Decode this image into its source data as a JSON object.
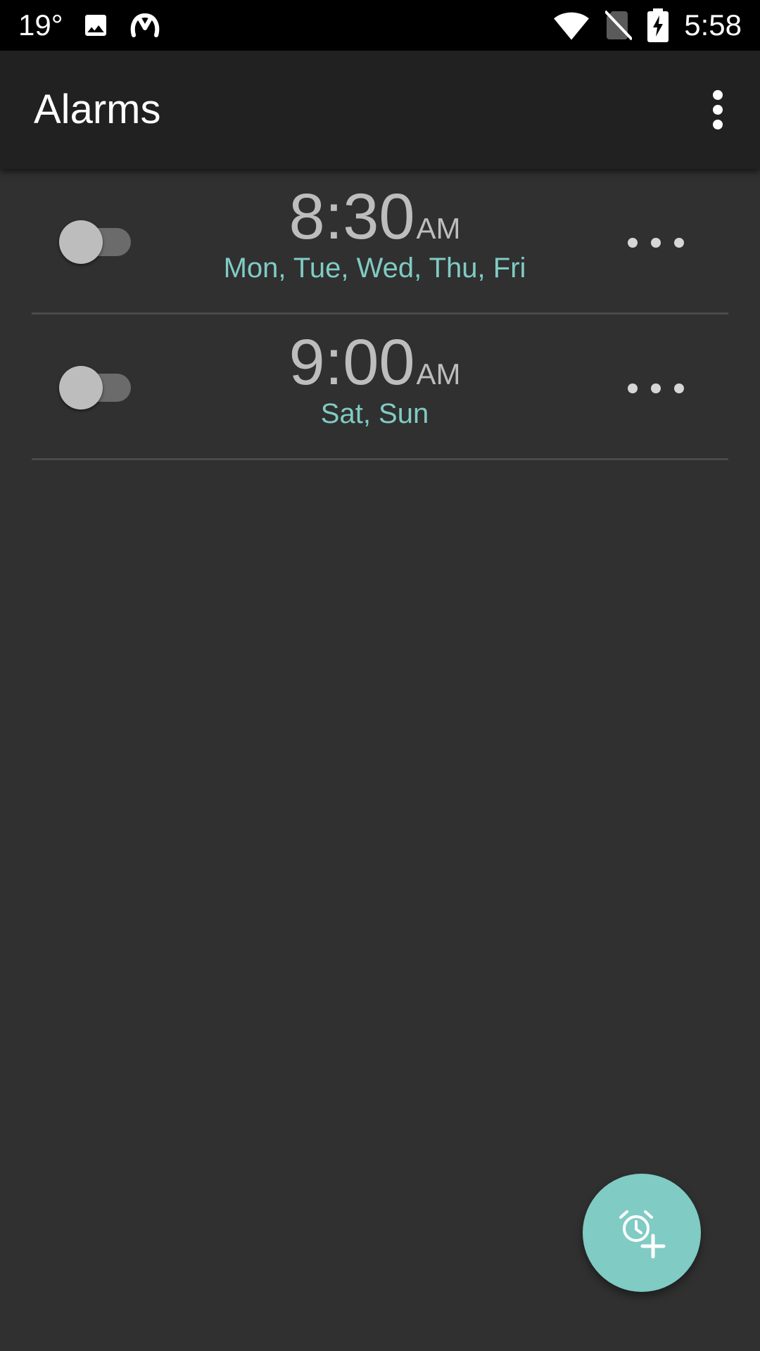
{
  "status_bar": {
    "temperature": "19°",
    "time": "5:58",
    "icons": [
      "image-icon",
      "notification-app-icon",
      "wifi-icon",
      "no-sim-icon",
      "battery-charging-icon"
    ]
  },
  "app_bar": {
    "title": "Alarms",
    "overflow_icon": "more-vert-icon"
  },
  "alarms": [
    {
      "time": "8:30",
      "ampm": "AM",
      "days": "Mon, Tue, Wed, Thu, Fri",
      "enabled": false
    },
    {
      "time": "9:00",
      "ampm": "AM",
      "days": "Sat, Sun",
      "enabled": false
    }
  ],
  "fab": {
    "icon": "add-alarm-icon"
  },
  "colors": {
    "accent": "#80cbc4",
    "background": "#303030",
    "app_bar": "#212121",
    "status_bar": "#000000",
    "time_text": "#bdbdbd"
  }
}
